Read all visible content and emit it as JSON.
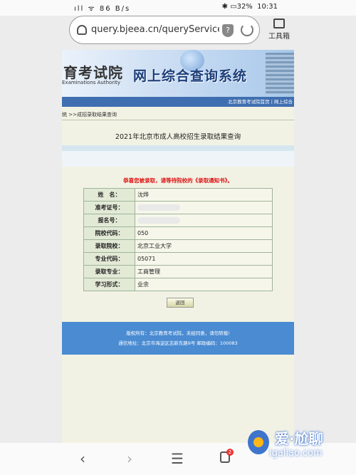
{
  "status": {
    "left": "86 B/s",
    "battery": "32%",
    "time": "10:31"
  },
  "browser": {
    "url": "query.bjeea.cn/queryService/r...",
    "tools_label": "工具箱"
  },
  "page": {
    "org_name": "育考试院",
    "org_en": "Examinations Authority",
    "system_title": "网上综合查询系统",
    "top_links": "北京教育考试院首页 | 网上综合",
    "breadcrumb": "统 >>成招录取结果查询",
    "title": "2021年北京市成人高校招生录取结果查询",
    "congrats": "恭喜您被录取，请等待院校的《录取通知书》。",
    "results": [
      {
        "label": "姓　名：",
        "value": "沈烨"
      },
      {
        "label": "准考证号：",
        "value": ""
      },
      {
        "label": "报名号：",
        "value": ""
      },
      {
        "label": "院校代码：",
        "value": "050"
      },
      {
        "label": "录取院校：",
        "value": "北京工业大学"
      },
      {
        "label": "专业代码：",
        "value": "05071"
      },
      {
        "label": "录取专业：",
        "value": "工商管理"
      },
      {
        "label": "学习形式：",
        "value": "业余"
      }
    ],
    "back_button": "返回",
    "footer_line1": "版权所有：北京教育考试院，未经同意，请勿转载!",
    "footer_line2": "通信地址：北京市海淀区志新东路9号 邮政编码：100083"
  },
  "navbar": {
    "back": "‹",
    "forward": "›",
    "menu": "☰",
    "tab_count": "2",
    "home": "⌂"
  },
  "watermark": {
    "brand": "爱·尬聊",
    "site": "igaliao.com"
  }
}
